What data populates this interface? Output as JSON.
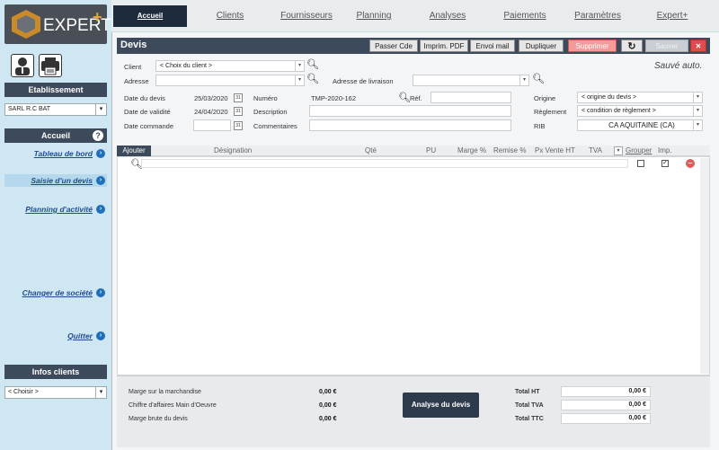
{
  "brand": {
    "name": "EXPERT",
    "plus": "+"
  },
  "sidebar": {
    "section1": "Etablissement",
    "company_select": "SARL R.C BAT",
    "section2": "Accueil",
    "help": "?",
    "links": {
      "tableau": "Tableau de bord",
      "saisie": "Saisie d'un devis",
      "planning": "Planning d'activité",
      "changer": "Changer de société",
      "quitter": "Quitter"
    },
    "section3": "Infos clients",
    "client_select": "< Choisir >"
  },
  "nav": {
    "tabs": [
      "Accueil",
      "Clients",
      "Fournisseurs",
      "Planning",
      "Analyses",
      "Paiements",
      "Paramètres",
      "Expert+"
    ]
  },
  "devis": {
    "title": "Devis",
    "buttons": {
      "passer": "Passer Cde",
      "imprim": "Imprim. PDF",
      "envoi": "Envoi mail",
      "dupliquer": "Dupliquer",
      "supprimer": "Supprimer",
      "refresh": "↻",
      "sauver": "Sauver",
      "close": "✕"
    },
    "autosave": "Sauvé auto.",
    "client_label": "Client",
    "client_value": "< Choix du client >",
    "adresse_label": "Adresse",
    "adresse_livraison_label": "Adresse de livraison",
    "date_devis_label": "Date du devis",
    "date_devis": "25/03/2020",
    "date_validite_label": "Date de validité",
    "date_validite": "24/04/2020",
    "date_commande_label": "Date commande",
    "numero_label": "Numéro",
    "numero": "TMP-2020-162",
    "ref_label": "Réf.",
    "description_label": "Description",
    "commentaires_label": "Commentaires",
    "origine_label": "Origine",
    "origine_value": "< origine du devis >",
    "reglement_label": "Règlement",
    "reglement_value": "< condition de règlement >",
    "rib_label": "RIB",
    "rib_value": "CA AQUITAINE (CA)",
    "cal_label": "31"
  },
  "lines": {
    "ajouter": "Ajouter",
    "headers": {
      "designation": "Désignation",
      "qte": "Qté",
      "pu": "PU",
      "marge": "Marge %",
      "remise": "Remise %",
      "pxvente": "Px Vente HT",
      "tva": "TVA",
      "grouper": "Grouper",
      "imp": "Imp."
    }
  },
  "footer": {
    "marge_marchandise_label": "Marge sur la marchandise",
    "marge_marchandise": "0,00 €",
    "ca_main_oeuvre_label": "Chiffre d'affaires Main d'Oeuvre",
    "ca_main_oeuvre": "0,00 €",
    "marge_brute_label": "Marge brute du devis",
    "marge_brute": "0,00 €",
    "analyse_button": "Analyse du devis",
    "total_ht_label": "Total HT",
    "total_ht": "0,00 €",
    "total_tva_label": "Total TVA",
    "total_tva": "0,00 €",
    "total_ttc_label": "Total TTC",
    "total_ttc": "0,00 €"
  }
}
